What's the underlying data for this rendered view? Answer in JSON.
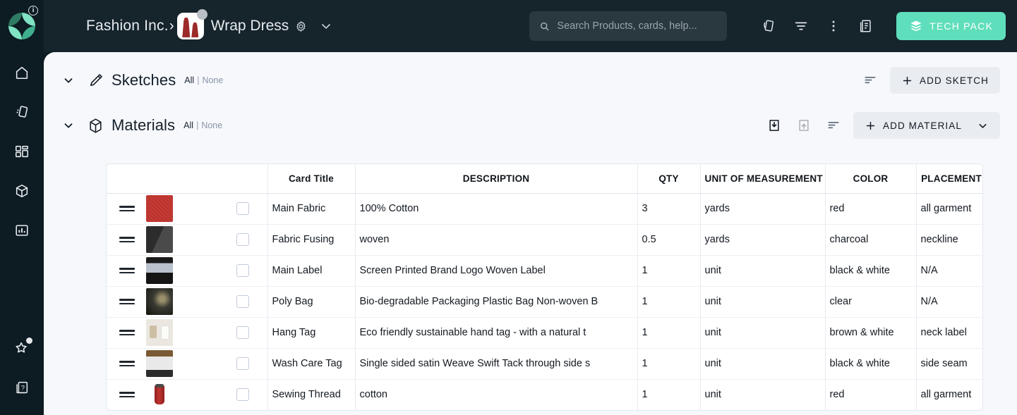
{
  "app": {
    "logo_name": "pinwheel-logo",
    "info_badge": "i",
    "accent_color": "#5fdebc",
    "topbar_bg": "#16242c",
    "rail_bg": "#0d1b22",
    "content_bg": "#f6f8fc"
  },
  "sidebar": {
    "items": [
      {
        "name": "home",
        "label": "Home"
      },
      {
        "name": "cards",
        "label": "Cards"
      },
      {
        "name": "boards",
        "label": "Boards"
      },
      {
        "name": "products",
        "label": "Products"
      },
      {
        "name": "reports",
        "label": "Reports"
      }
    ],
    "bottom_items": [
      {
        "name": "favorites",
        "label": "Favorites",
        "has_badge": true
      },
      {
        "name": "help",
        "label": "Help"
      }
    ]
  },
  "topbar": {
    "org": "Fashion Inc.",
    "separator": "›",
    "product": "Wrap Dress",
    "product_thumb": "wrap-dress-thumbnail",
    "settings_icon": "gear-icon",
    "dropdown_icon": "chevron-down-icon",
    "search": {
      "placeholder": "Search Products, cards, help...",
      "value": "",
      "icon": "search-icon"
    },
    "actions": [
      {
        "name": "cards-icon",
        "label": "Cards"
      },
      {
        "name": "filter-icon",
        "label": "Filter"
      },
      {
        "name": "more-vertical-icon",
        "label": "More"
      },
      {
        "name": "notes-icon",
        "label": "Notes"
      }
    ],
    "tech_pack": {
      "label": "TECH PACK",
      "icon": "layers-icon"
    }
  },
  "sections": [
    {
      "key": "sketches",
      "title": "Sketches",
      "icon": "pencil-icon",
      "collapse_icon": "chevron-down-icon",
      "select_all": "All",
      "select_bar": "|",
      "select_none": "None",
      "actions": [
        {
          "name": "sort-icon",
          "label": "Sort",
          "disabled": false
        }
      ],
      "primary_button": {
        "label": "ADD SKETCH",
        "icon": "plus-icon",
        "has_split": false
      }
    },
    {
      "key": "materials",
      "title": "Materials",
      "icon": "cube-icon",
      "collapse_icon": "chevron-down-icon",
      "select_all": "All",
      "select_bar": "|",
      "select_none": "None",
      "actions": [
        {
          "name": "import-icon",
          "label": "Import",
          "disabled": false
        },
        {
          "name": "export-icon",
          "label": "Export",
          "disabled": true
        },
        {
          "name": "sort-icon",
          "label": "Sort",
          "disabled": false
        }
      ],
      "primary_button": {
        "label": "ADD MATERIAL",
        "icon": "plus-icon",
        "has_split": true,
        "split_icon": "chevron-down-icon"
      }
    }
  ],
  "table": {
    "columns": [
      {
        "key": "handle",
        "label": ""
      },
      {
        "key": "title",
        "label": "Card Title"
      },
      {
        "key": "description",
        "label": "DESCRIPTION"
      },
      {
        "key": "qty",
        "label": "QTY"
      },
      {
        "key": "uom",
        "label": "UNIT OF MEASUREMENT"
      },
      {
        "key": "color",
        "label": "COLOR"
      },
      {
        "key": "placement",
        "label": "PLACEMENT"
      },
      {
        "key": "settings",
        "label": "columns-icon"
      }
    ],
    "rows": [
      {
        "thumb": "th-fabric",
        "thumb_name": "material-thumbnail-main-fabric",
        "checked": false,
        "title": "Main Fabric",
        "description": "100% Cotton",
        "qty": "3",
        "uom": "yards",
        "color": "red",
        "placement": "all garment"
      },
      {
        "thumb": "th-fusing",
        "thumb_name": "material-thumbnail-fabric-fusing",
        "checked": false,
        "title": "Fabric Fusing",
        "description": "woven",
        "qty": "0.5",
        "uom": "yards",
        "color": "charcoal",
        "placement": "neckline"
      },
      {
        "thumb": "th-label",
        "thumb_name": "material-thumbnail-main-label",
        "checked": false,
        "title": "Main Label",
        "description": "Screen Printed Brand Logo Woven Label",
        "qty": "1",
        "uom": "unit",
        "color": "black & white",
        "placement": "N/A"
      },
      {
        "thumb": "th-polybag",
        "thumb_name": "material-thumbnail-poly-bag",
        "checked": false,
        "title": "Poly Bag",
        "description": "Bio-degradable Packaging Plastic Bag Non-woven B",
        "qty": "1",
        "uom": "unit",
        "color": "clear",
        "placement": "N/A"
      },
      {
        "thumb": "th-hangtag",
        "thumb_name": "material-thumbnail-hang-tag",
        "checked": false,
        "title": "Hang Tag",
        "description": "Eco friendly sustainable hand tag - with a natural t",
        "qty": "1",
        "uom": "unit",
        "color": "brown & white",
        "placement": "neck label"
      },
      {
        "thumb": "th-washtag",
        "thumb_name": "material-thumbnail-wash-care-tag",
        "checked": false,
        "title": "Wash Care Tag",
        "description": "Single sided satin Weave Swift Tack through side s",
        "qty": "1",
        "uom": "unit",
        "color": "black & white",
        "placement": "side seam"
      },
      {
        "thumb": "th-thread",
        "thumb_name": "material-thumbnail-sewing-thread",
        "checked": false,
        "title": "Sewing Thread",
        "description": "cotton",
        "qty": "1",
        "uom": "unit",
        "color": "red",
        "placement": "all garment"
      }
    ],
    "row_settings_icon": "gear-icon"
  }
}
